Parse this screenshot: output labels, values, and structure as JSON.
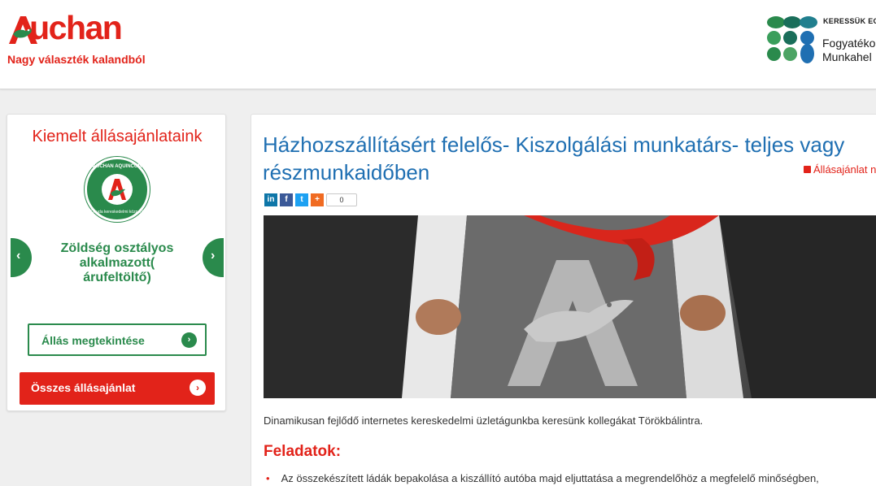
{
  "header": {
    "logo_text": "Auchan",
    "tagline": "Nagy választék kalandból",
    "partner_small": "KERESSÜK EG",
    "partner_line1": "Fogyatéko",
    "partner_line2": "Munkahel",
    "colors": {
      "brand_red": "#e2231a",
      "dots": [
        "#2a8a4c",
        "#3a9e5b",
        "#1a6e5a",
        "#217f8e",
        "#1f6fb2",
        "#4ca464"
      ]
    }
  },
  "sidebar": {
    "title": "Kiemelt állásajánlataink",
    "badge_top": "AUCHAN AQUINCUM",
    "badge_bottom": "Óbuda kereskedelmi központ",
    "prev_icon": "chevron-left-icon",
    "next_icon": "chevron-right-icon",
    "job_title": "Zöldség osztályos alkalmazott( árufeltöltő)",
    "view_button": "Állás megtekintése",
    "all_button": "Összes állásajánlat"
  },
  "main": {
    "title": "Házhozszállításért felelős- Kiszolgálási munkatárs- teljes vagy részmunkaidőben",
    "print_link": "Állásajánlat n",
    "share": {
      "linkedin": "in",
      "facebook": "f",
      "twitter": "t",
      "plus": "+",
      "count": "0"
    },
    "hero_alt": "superhero-shirt-auchan-logo",
    "intro": "Dinamikusan fejlődő internetes kereskedelmi üzletágunkba keresünk kollegákat Törökbálintra.",
    "tasks_heading": "Feladatok:",
    "tasks": [
      "Az összekészített ládák bepakolása a kiszállító autóba majd eljuttatása a megrendelőhöz a megfelelő minőségben,"
    ]
  }
}
